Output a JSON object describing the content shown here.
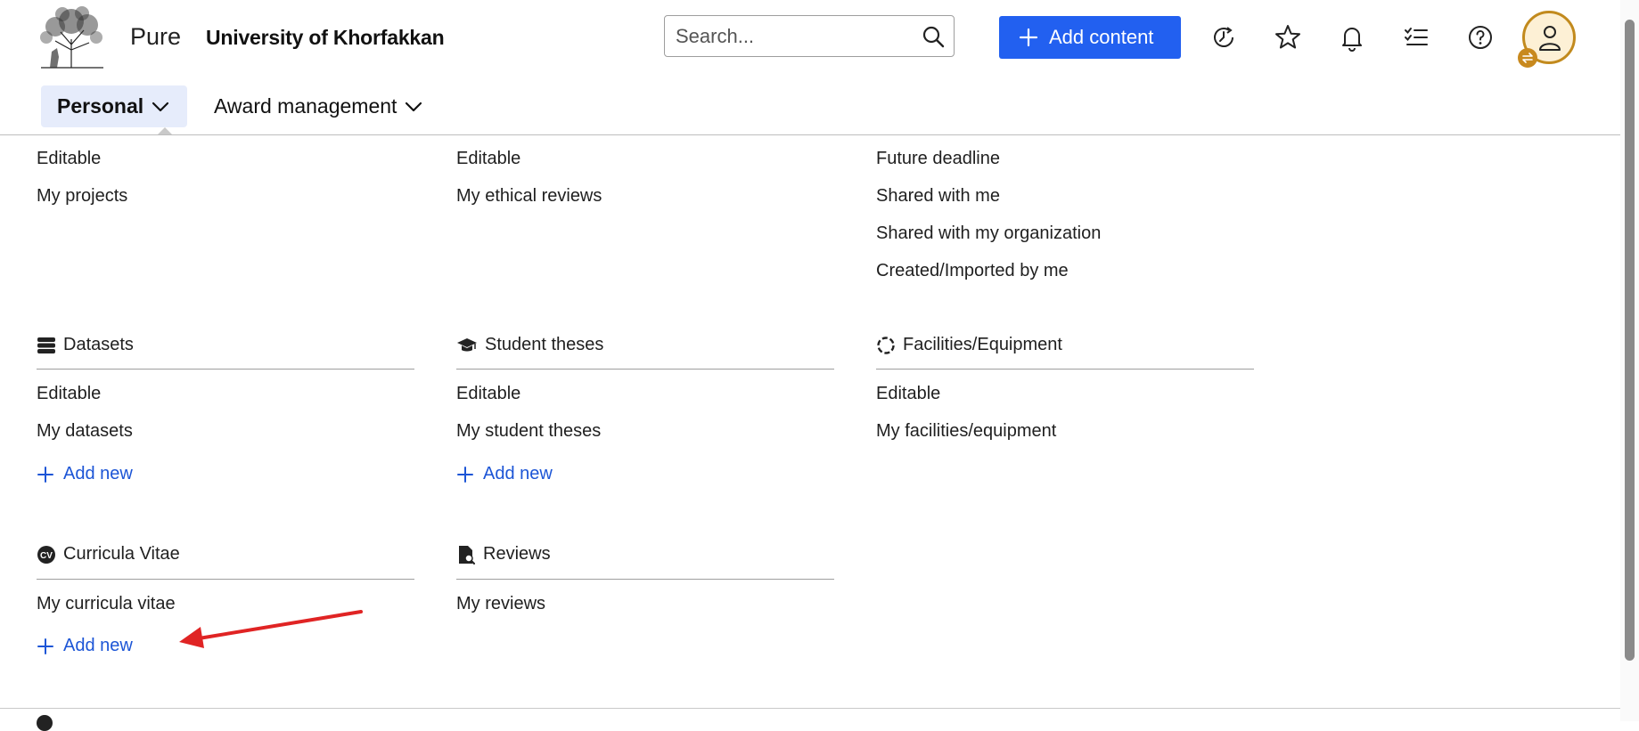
{
  "header": {
    "app_name": "Pure",
    "org_name": "University of Khorfakkan",
    "search_placeholder": "Search...",
    "add_content_label": "Add content",
    "icons": [
      "history-icon",
      "star-icon",
      "bell-icon",
      "tasks-icon",
      "help-icon",
      "user-icon"
    ]
  },
  "tabs": [
    {
      "label": "Personal",
      "active": true
    },
    {
      "label": "Award management",
      "active": false
    }
  ],
  "columns": [
    {
      "top_items": [
        "Editable",
        "My projects"
      ],
      "sections": [
        {
          "title": "Datasets",
          "icon": "database-icon",
          "items": [
            "Editable",
            "My datasets"
          ],
          "add_label": "Add new"
        },
        {
          "title": "Curricula Vitae",
          "icon": "cv-icon",
          "items": [
            "My curricula vitae"
          ],
          "add_label": "Add new"
        }
      ]
    },
    {
      "top_items": [
        "Editable",
        "My ethical reviews"
      ],
      "sections": [
        {
          "title": "Student theses",
          "icon": "graduation-cap-icon",
          "items": [
            "Editable",
            "My student theses"
          ],
          "add_label": "Add new"
        },
        {
          "title": "Reviews",
          "icon": "document-search-icon",
          "items": [
            "My reviews"
          ]
        }
      ]
    },
    {
      "top_items": [
        "Future deadline",
        "Shared with me",
        "Shared with my organization",
        "Created/Imported by me"
      ],
      "sections": [
        {
          "title": "Facilities/Equipment",
          "icon": "facility-icon",
          "items": [
            "Editable",
            "My facilities/equipment"
          ]
        }
      ]
    }
  ],
  "colors": {
    "primary_button": "#2260f0",
    "link": "#1c55d6",
    "active_tab_bg": "#e6ecfb",
    "avatar_border": "#c28a1d",
    "annotation_arrow": "#e02424"
  }
}
